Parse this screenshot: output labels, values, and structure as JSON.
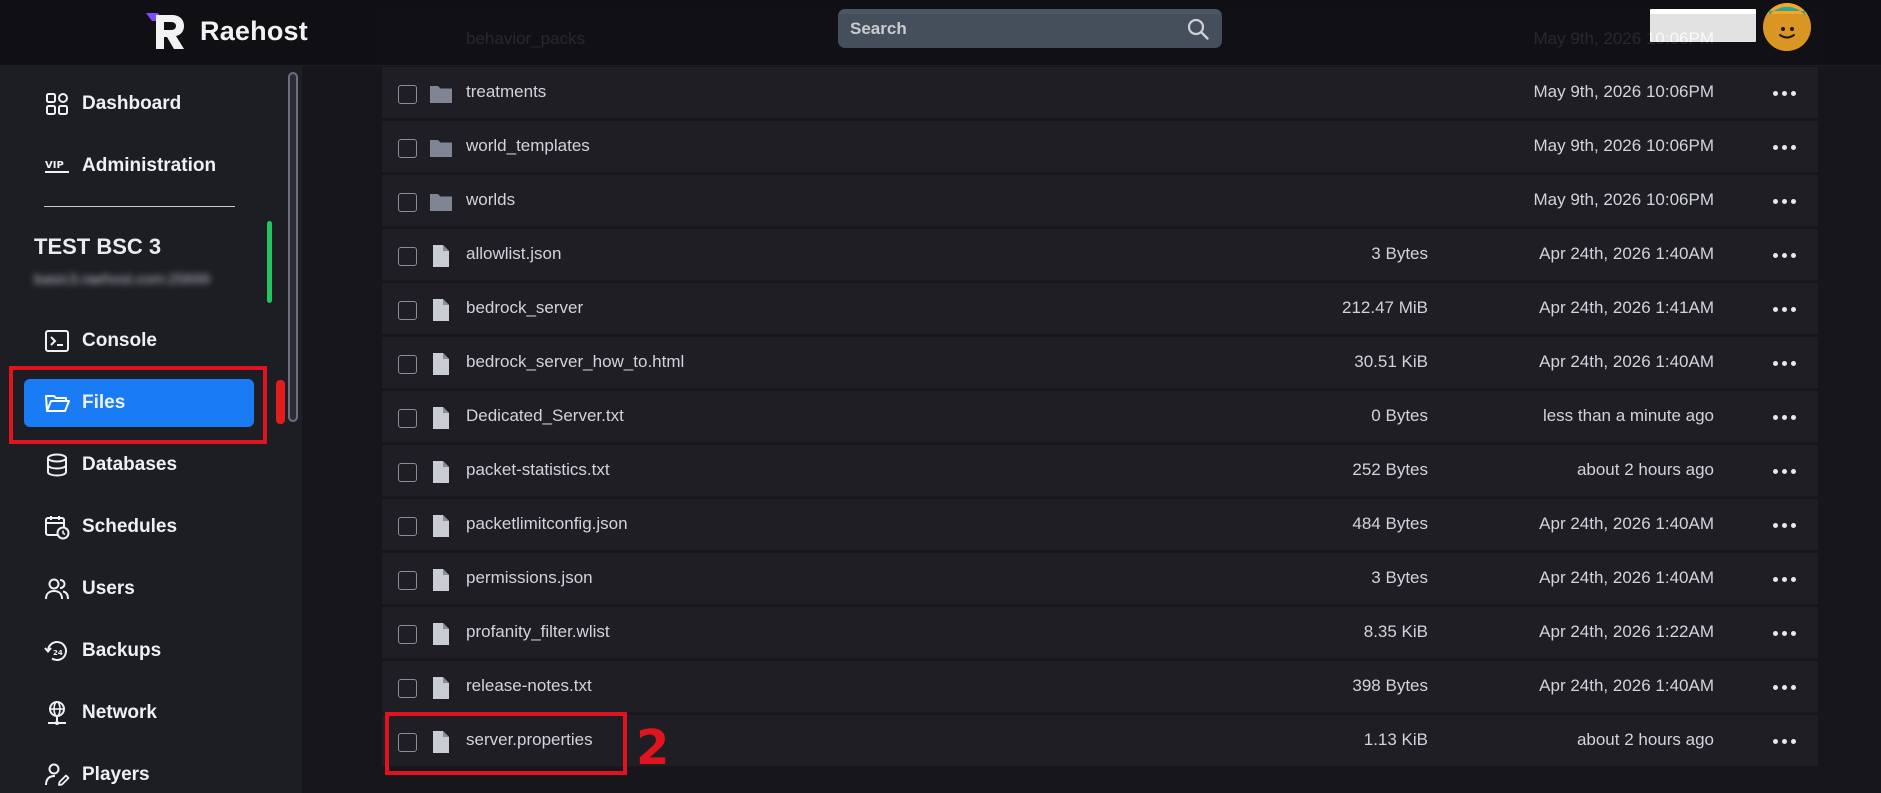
{
  "app": {
    "brand_name": "Raehost",
    "accent_color": "#1a7cf5"
  },
  "search": {
    "placeholder": "Search"
  },
  "sidebar": {
    "top_items": [
      {
        "label": "Dashboard",
        "icon": "grid-icon"
      },
      {
        "label": "Administration",
        "icon": "vip-icon"
      }
    ],
    "server": {
      "name": "TEST BSC 3",
      "address": "basic3.raehost.com:25699"
    },
    "items": [
      {
        "label": "Console",
        "icon": "terminal-icon"
      },
      {
        "label": "Files",
        "icon": "folder-open-icon",
        "active": true
      },
      {
        "label": "Databases",
        "icon": "database-icon"
      },
      {
        "label": "Schedules",
        "icon": "calendar-clock-icon"
      },
      {
        "label": "Users",
        "icon": "users-icon"
      },
      {
        "label": "Backups",
        "icon": "backup-icon"
      },
      {
        "label": "Network",
        "icon": "network-icon"
      },
      {
        "label": "Players",
        "icon": "user-edit-icon"
      }
    ]
  },
  "files": {
    "ghost_row": {
      "name": "behavior_packs",
      "date": "May 9th, 2026 10:06PM"
    },
    "rows": [
      {
        "name": "treatments",
        "type": "folder",
        "size": "",
        "modified": "May 9th, 2026 10:06PM"
      },
      {
        "name": "world_templates",
        "type": "folder",
        "size": "",
        "modified": "May 9th, 2026 10:06PM"
      },
      {
        "name": "worlds",
        "type": "folder",
        "size": "",
        "modified": "May 9th, 2026 10:06PM"
      },
      {
        "name": "allowlist.json",
        "type": "file",
        "size": "3 Bytes",
        "modified": "Apr 24th, 2026 1:40AM"
      },
      {
        "name": "bedrock_server",
        "type": "file",
        "size": "212.47 MiB",
        "modified": "Apr 24th, 2026 1:41AM"
      },
      {
        "name": "bedrock_server_how_to.html",
        "type": "file",
        "size": "30.51 KiB",
        "modified": "Apr 24th, 2026 1:40AM"
      },
      {
        "name": "Dedicated_Server.txt",
        "type": "file",
        "size": "0 Bytes",
        "modified": "less than a minute ago"
      },
      {
        "name": "packet-statistics.txt",
        "type": "file",
        "size": "252 Bytes",
        "modified": "about 2 hours ago"
      },
      {
        "name": "packetlimitconfig.json",
        "type": "file",
        "size": "484 Bytes",
        "modified": "Apr 24th, 2026 1:40AM"
      },
      {
        "name": "permissions.json",
        "type": "file",
        "size": "3 Bytes",
        "modified": "Apr 24th, 2026 1:40AM"
      },
      {
        "name": "profanity_filter.wlist",
        "type": "file",
        "size": "8.35 KiB",
        "modified": "Apr 24th, 2026 1:22AM"
      },
      {
        "name": "release-notes.txt",
        "type": "file",
        "size": "398 Bytes",
        "modified": "Apr 24th, 2026 1:40AM"
      },
      {
        "name": "server.properties",
        "type": "file",
        "size": "1.13 KiB",
        "modified": "about 2 hours ago"
      }
    ]
  },
  "annotations": {
    "step_number": "2",
    "color": "#e0141e"
  }
}
